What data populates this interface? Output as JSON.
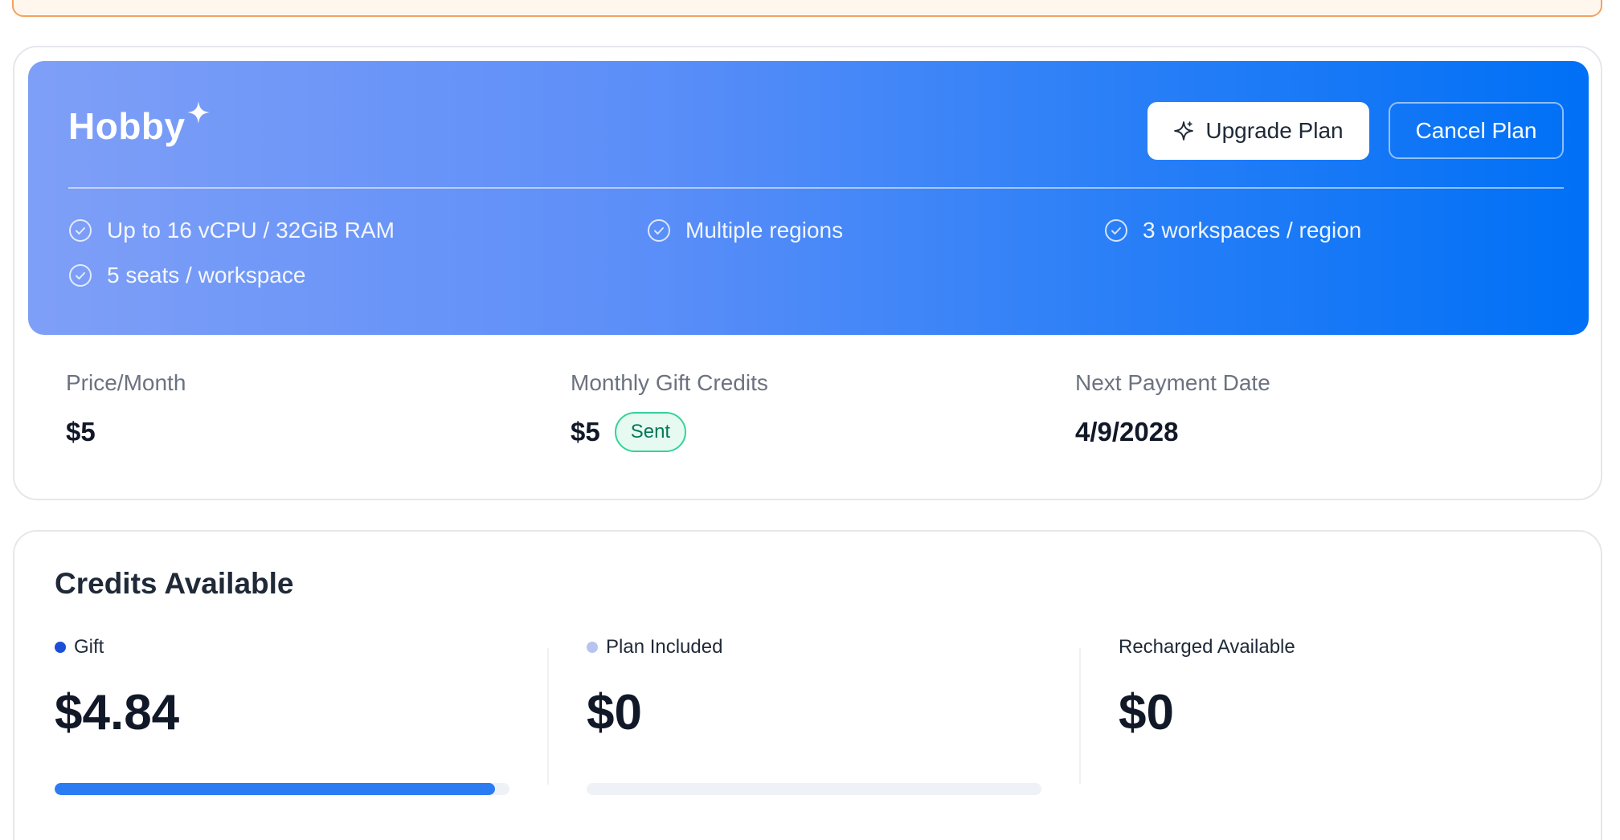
{
  "plan": {
    "name": "Hobby",
    "upgrade_label": "Upgrade Plan",
    "cancel_label": "Cancel Plan",
    "features": [
      "Up to 16 vCPU / 32GiB RAM",
      "Multiple regions",
      "3 workspaces / region",
      "5 seats / workspace"
    ],
    "price_label": "Price/Month",
    "price_value": "$5",
    "gift_credits_label": "Monthly Gift Credits",
    "gift_credits_value": "$5",
    "gift_credits_status": "Sent",
    "next_payment_label": "Next Payment Date",
    "next_payment_value": "4/9/2028"
  },
  "credits": {
    "title": "Credits Available",
    "columns": [
      {
        "label": "Gift",
        "value": "$4.84",
        "dot_color": "#1d4ed8",
        "progress": 0.968
      },
      {
        "label": "Plan Included",
        "value": "$0",
        "dot_color": "#b8c4f0",
        "progress": 0
      },
      {
        "label": "Recharged Available",
        "value": "$0"
      }
    ]
  },
  "colors": {
    "accent": "#0070f6",
    "progress": "#2b7cf3",
    "badge_border": "#34d399",
    "alert_border": "#f4a261"
  }
}
